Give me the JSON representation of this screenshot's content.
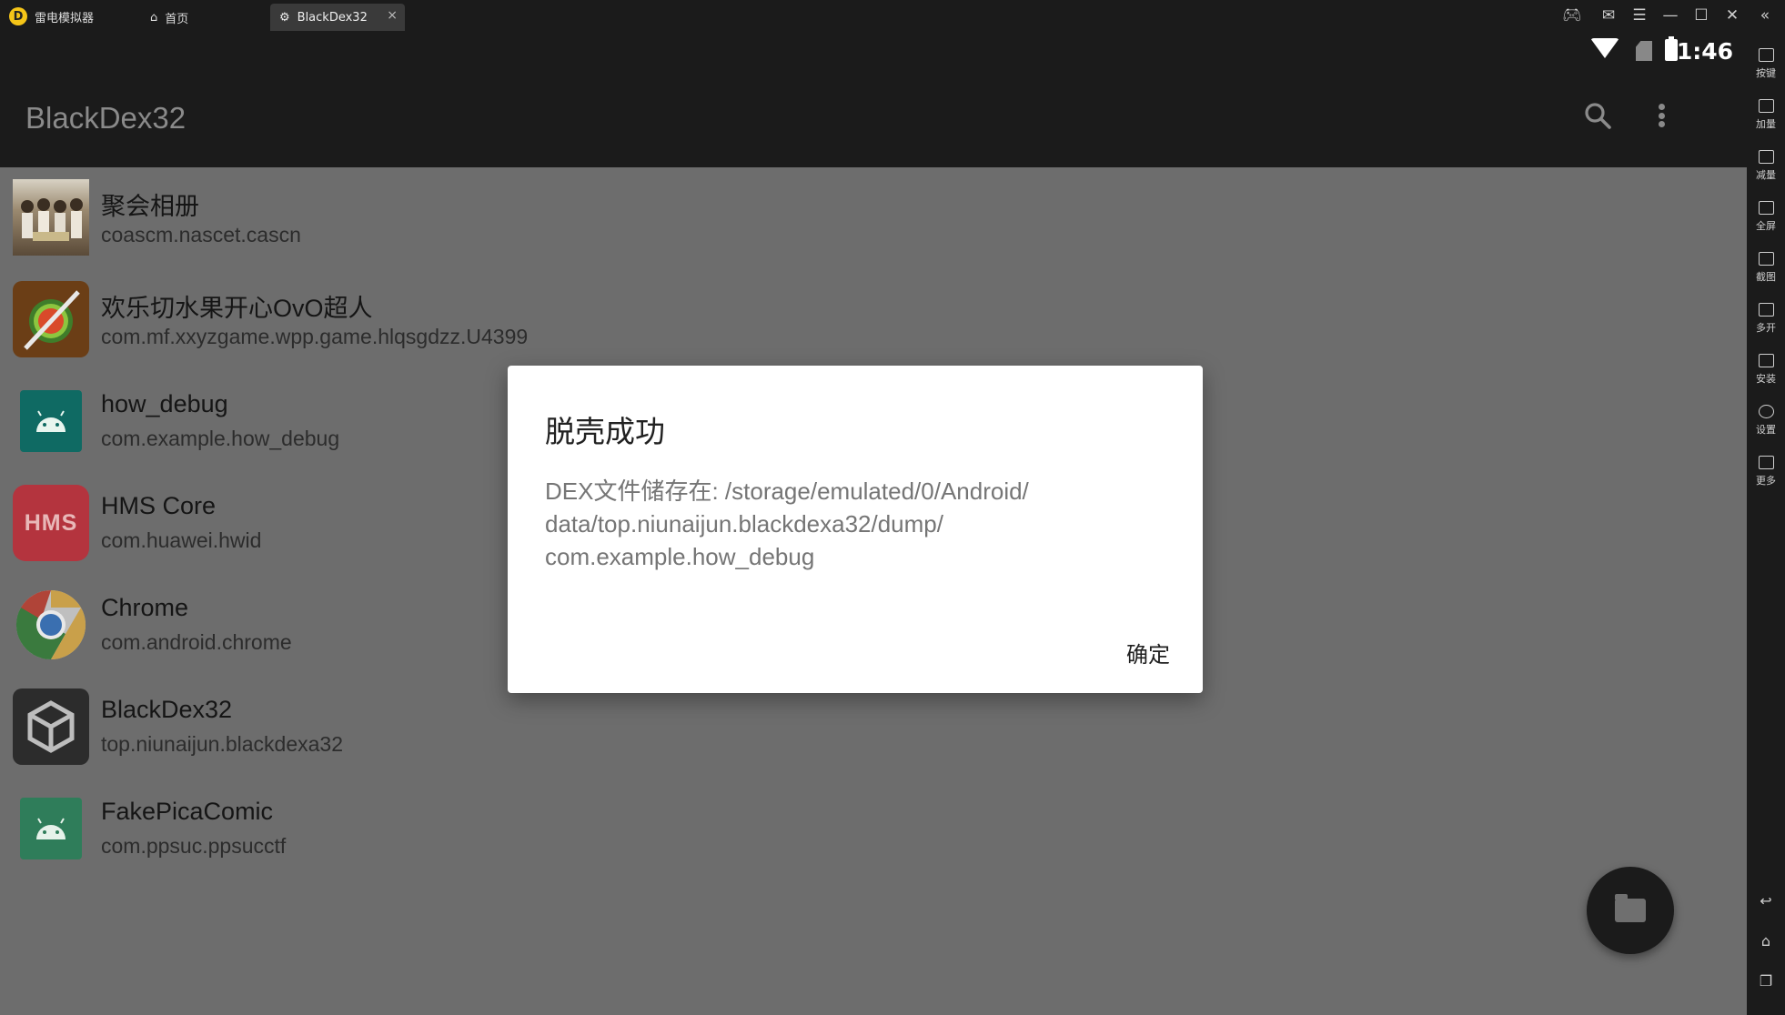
{
  "emulator": {
    "app_name": "雷电模拟器",
    "tabs": [
      {
        "label": "首页",
        "icon": "home-icon",
        "active": false
      },
      {
        "label": "BlackDex32",
        "icon": "app-icon",
        "active": true
      }
    ],
    "window_controls": [
      "gamepad-icon",
      "mail-icon",
      "menu-icon",
      "minimize-icon",
      "maximize-icon",
      "close-icon",
      "collapse-sidebar-icon"
    ],
    "sidebar": [
      {
        "label": "按键",
        "icon": "keyboard-icon"
      },
      {
        "label": "加量",
        "icon": "volume-up-icon"
      },
      {
        "label": "减量",
        "icon": "volume-down-icon"
      },
      {
        "label": "全屏",
        "icon": "fullscreen-icon"
      },
      {
        "label": "截图",
        "icon": "scissors-icon"
      },
      {
        "label": "多开",
        "icon": "multi-instance-icon"
      },
      {
        "label": "安装",
        "icon": "apk-install-icon"
      },
      {
        "label": "设置",
        "icon": "settings-gear-icon"
      },
      {
        "label": "更多",
        "icon": "more-icon"
      }
    ],
    "nav_buttons": [
      "back-icon",
      "home-icon",
      "recents-icon"
    ]
  },
  "status_bar": {
    "time": "1:46"
  },
  "app_bar": {
    "title": "BlackDex32"
  },
  "apps": [
    {
      "name": "聚会相册",
      "package": "coascm.nascet.cascn",
      "icon": "photo-album-icon",
      "color": "#8a7a62"
    },
    {
      "name": "欢乐切水果开心OvO超人",
      "package": "com.mf.xxyzgame.wpp.game.hlqsgdzz.U4399",
      "icon": "fruit-ninja-icon",
      "color": "#7a4a1e"
    },
    {
      "name": "how_debug",
      "package": "com.example.how_debug",
      "icon": "android-icon",
      "color": "#0f6a63"
    },
    {
      "name": "HMS Core",
      "package": "com.huawei.hwid",
      "icon": "hms-core-icon",
      "color": "#b0303a",
      "icon_text": "HMS"
    },
    {
      "name": "Chrome",
      "package": "com.android.chrome",
      "icon": "chrome-icon",
      "color": "#cfcfcf"
    },
    {
      "name": "BlackDex32",
      "package": "top.niunaijun.blackdexa32",
      "icon": "blackdex-cube-icon",
      "color": "#2a2a2a"
    },
    {
      "name": "FakePicaComic",
      "package": "com.ppsuc.ppsucctf",
      "icon": "android-icon",
      "color": "#2f7d5a"
    }
  ],
  "dialog": {
    "title": "脱壳成功",
    "message": "DEX文件储存在: /storage/emulated/0/Android/\ndata/top.niunaijun.blackdexa32/dump/\ncom.example.how_debug",
    "ok_label": "确定"
  }
}
